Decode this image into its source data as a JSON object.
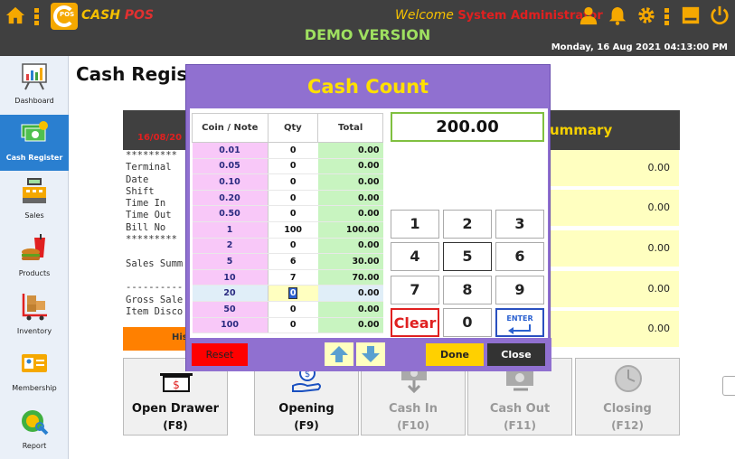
{
  "header": {
    "logo_text_a": "CASH",
    "logo_text_b": "POS",
    "logo_badge": "POS",
    "welcome_prefix": "Welcome",
    "user": "System Administrator",
    "banner": "DEMO VERSION",
    "datetime": "Monday, 16 Aug 2021 04:13:00 PM",
    "icons": [
      "home-icon",
      "menu-dots-icon",
      "user-icon",
      "bell-icon",
      "gear-icon",
      "menu-dots-icon",
      "minimize-icon",
      "power-icon"
    ],
    "accent": "#f5a800",
    "bar_color": "#404040"
  },
  "sidebar": {
    "items": [
      {
        "label": "Dashboard",
        "icon": "chart-icon"
      },
      {
        "label": "Cash Register",
        "icon": "cash-icon",
        "active": true
      },
      {
        "label": "Sales",
        "icon": "register-icon"
      },
      {
        "label": "Products",
        "icon": "food-icon"
      },
      {
        "label": "Inventory",
        "icon": "inventory-icon"
      },
      {
        "label": "Membership",
        "icon": "membership-card-icon"
      },
      {
        "label": "Report",
        "icon": "report-icon"
      }
    ],
    "active_color": "#2a7fd0"
  },
  "main": {
    "title": "Cash Regist",
    "receipt_date": "16/08/20",
    "summary_header": "ummary",
    "receipt_lines": "*********\nTerminal\nDate\nShift\nTime In\nTime Out\nBill No\n*********\n\nSales Summ\n\n----------\nGross Sale\nItem Disco",
    "history_label": "His",
    "summary_values": [
      "0.00",
      "0.00",
      "0.00",
      "0.00",
      "0.00"
    ],
    "actions": [
      {
        "title": "Open Drawer",
        "key": "(F8)",
        "icon": "cash-drawer-icon",
        "enabled": true
      },
      {
        "title": "Opening",
        "key": "(F9)",
        "icon": "hand-coin-icon",
        "enabled": true
      },
      {
        "title": "Cash In",
        "key": "(F10)",
        "icon": "cash-in-icon",
        "enabled": false
      },
      {
        "title": "Cash Out",
        "key": "(F11)",
        "icon": "cash-out-icon",
        "enabled": false
      },
      {
        "title": "Closing",
        "key": "(F12)",
        "icon": "clock-icon",
        "enabled": false
      }
    ]
  },
  "modal": {
    "title": "Cash Count",
    "columns": [
      "Coin / Note",
      "Qty",
      "Total"
    ],
    "rows": [
      {
        "coin": "0.01",
        "qty": "0",
        "total": "0.00"
      },
      {
        "coin": "0.05",
        "qty": "0",
        "total": "0.00"
      },
      {
        "coin": "0.10",
        "qty": "0",
        "total": "0.00"
      },
      {
        "coin": "0.20",
        "qty": "0",
        "total": "0.00"
      },
      {
        "coin": "0.50",
        "qty": "0",
        "total": "0.00"
      },
      {
        "coin": "1",
        "qty": "100",
        "total": "100.00"
      },
      {
        "coin": "2",
        "qty": "0",
        "total": "0.00"
      },
      {
        "coin": "5",
        "qty": "6",
        "total": "30.00"
      },
      {
        "coin": "10",
        "qty": "7",
        "total": "70.00"
      },
      {
        "coin": "20",
        "qty": "0",
        "total": "0.00",
        "selected": true
      },
      {
        "coin": "50",
        "qty": "0",
        "total": "0.00"
      },
      {
        "coin": "100",
        "qty": "0",
        "total": "0.00"
      }
    ],
    "display_value": "200.00",
    "keys": [
      "1",
      "2",
      "3",
      "4",
      "5",
      "6",
      "7",
      "8",
      "9"
    ],
    "clear_label": "Clear",
    "zero_label": "0",
    "enter_label": "ENTER",
    "reset_label": "Reset",
    "done_label": "Done",
    "close_label": "Close",
    "modal_color": "#9070d0",
    "title_color": "#ffe000"
  }
}
